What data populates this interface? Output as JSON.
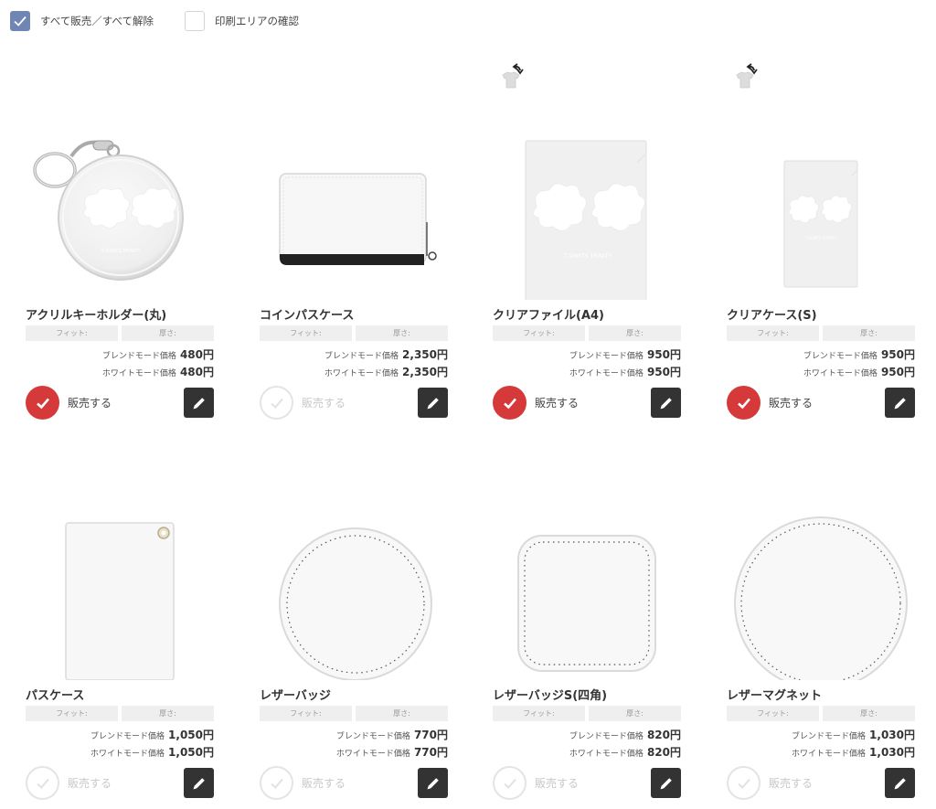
{
  "top": {
    "select_all_label": "すべて販売／すべて解除",
    "select_all_checked": true,
    "print_area_label": "印刷エリアの確認",
    "print_area_checked": false
  },
  "colors": {
    "check_active": "#6f86b5",
    "sell_active": "#d6393a",
    "edit_button": "#333333"
  },
  "labels": {
    "fit": "フィット:",
    "thickness": "厚さ:",
    "blend_price": "ブレンドモード価格",
    "white_price": "ホワイトモード価格",
    "sell": "販売する"
  },
  "products": [
    {
      "name": "アクリルキーホルダー(丸)",
      "blend": "480円",
      "white": "480円",
      "selling": true,
      "rotatable": false,
      "image": "acrylic-keychain"
    },
    {
      "name": "コインパスケース",
      "blend": "2,350円",
      "white": "2,350円",
      "selling": false,
      "rotatable": false,
      "image": "coin-pass-case"
    },
    {
      "name": "クリアファイル(A4)",
      "blend": "950円",
      "white": "950円",
      "selling": true,
      "rotatable": true,
      "image": "clear-file-a4"
    },
    {
      "name": "クリアケース(S)",
      "blend": "950円",
      "white": "950円",
      "selling": true,
      "rotatable": true,
      "image": "clear-case-s"
    },
    {
      "name": "パスケース",
      "blend": "1,050円",
      "white": "1,050円",
      "selling": false,
      "rotatable": false,
      "image": "pass-case"
    },
    {
      "name": "レザーバッジ",
      "blend": "770円",
      "white": "770円",
      "selling": false,
      "rotatable": false,
      "image": "leather-badge"
    },
    {
      "name": "レザーバッジS(四角)",
      "blend": "820円",
      "white": "820円",
      "selling": false,
      "rotatable": false,
      "image": "leather-badge-square"
    },
    {
      "name": "レザーマグネット",
      "blend": "1,030円",
      "white": "1,030円",
      "selling": false,
      "rotatable": false,
      "image": "leather-magnet"
    }
  ]
}
